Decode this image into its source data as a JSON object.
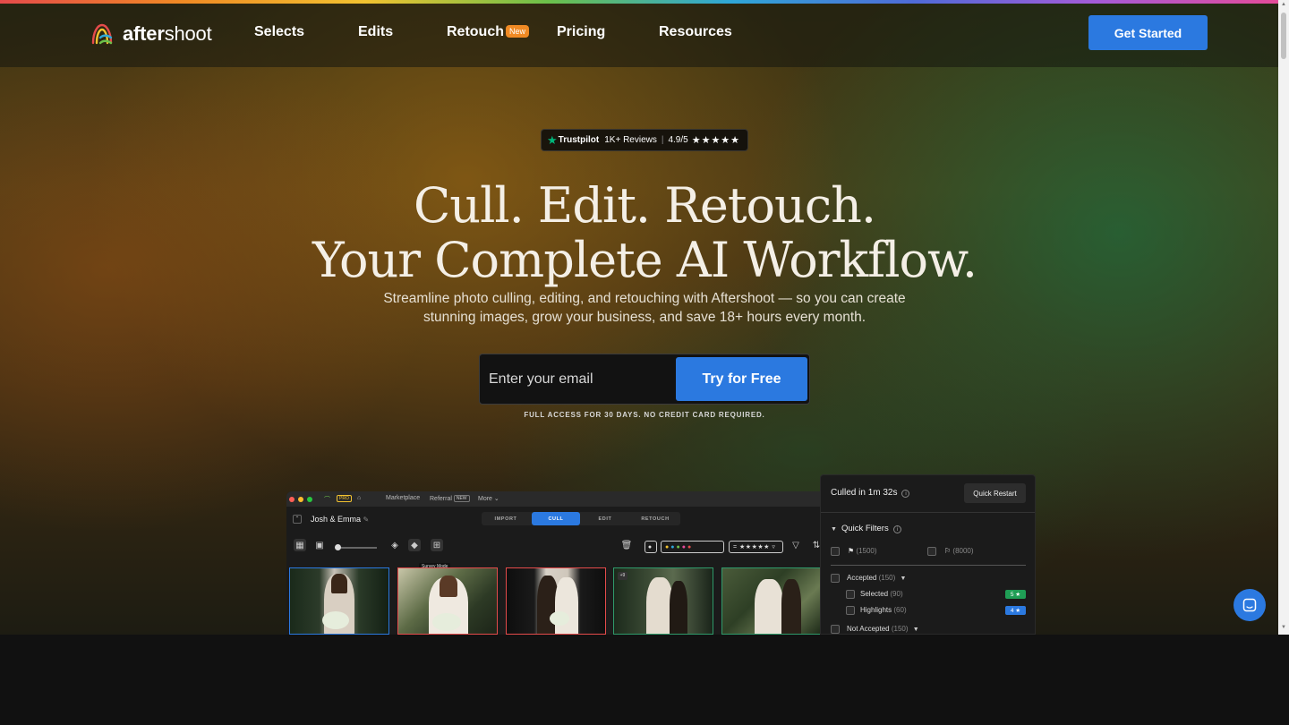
{
  "nav": {
    "logo_bold": "after",
    "logo_rest": "shoot",
    "links": [
      "Selects",
      "Edits",
      "Retouch",
      "Pricing",
      "Resources"
    ],
    "retouch_badge": "New",
    "cta": "Get Started"
  },
  "trust": {
    "brand": "Trustpilot",
    "reviews": "1K+ Reviews",
    "separator": "|",
    "rating": "4.9/5",
    "stars": "★★★★★"
  },
  "hero": {
    "line1": "Cull. Edit. Retouch.",
    "line2": "Your Complete AI Workflow.",
    "subtitle": "Streamline photo culling, editing, and retouching with Aftershoot — so you can create stunning images, grow your business, and save 18+ hours every month.",
    "email_placeholder": "Enter your email",
    "cta": "Try for Free",
    "fine_print": "FULL ACCESS FOR 30 DAYS. NO CREDIT CARD REQUIRED."
  },
  "app": {
    "pro_badge": "PRO",
    "menu": [
      "Marketplace",
      "Referral",
      "More ⌄"
    ],
    "referral_badge": "NEW",
    "project": "Josh & Emma",
    "tabs": [
      "IMPORT",
      "CULL",
      "EDIT",
      "RETOUCH"
    ],
    "active_tab": "CULL",
    "tooltip": "Survey Mode",
    "star_filter": "= ★★★★★ ▿",
    "thumb_badge": "+9"
  },
  "panel": {
    "culled": "Culled in 1m 32s",
    "restart": "Quick Restart",
    "quick_filters": "Quick Filters",
    "flag_count_1": "(1500)",
    "flag_count_2": "(8000)",
    "accepted": "Accepted",
    "accepted_count": "(150)",
    "selected": "Selected",
    "selected_count": "(90)",
    "selected_pill": "5 ★",
    "highlights": "Highlights",
    "highlights_count": "(60)",
    "highlights_pill": "4 ★",
    "not_accepted": "Not Accepted",
    "not_accepted_count": "(150)"
  },
  "colors": {
    "accent": "#2b79e0",
    "badge": "#f08a24",
    "trustpilot": "#00b67a"
  },
  "icons": [
    "logo-mark",
    "trustpilot-star",
    "edit-pencil-icon",
    "grid-icon",
    "layers-icon",
    "survey-mode-icon",
    "trash-icon",
    "filter-icon",
    "sort-icon",
    "flag-icon",
    "info-icon",
    "chevron-down-icon",
    "chat-icon"
  ]
}
